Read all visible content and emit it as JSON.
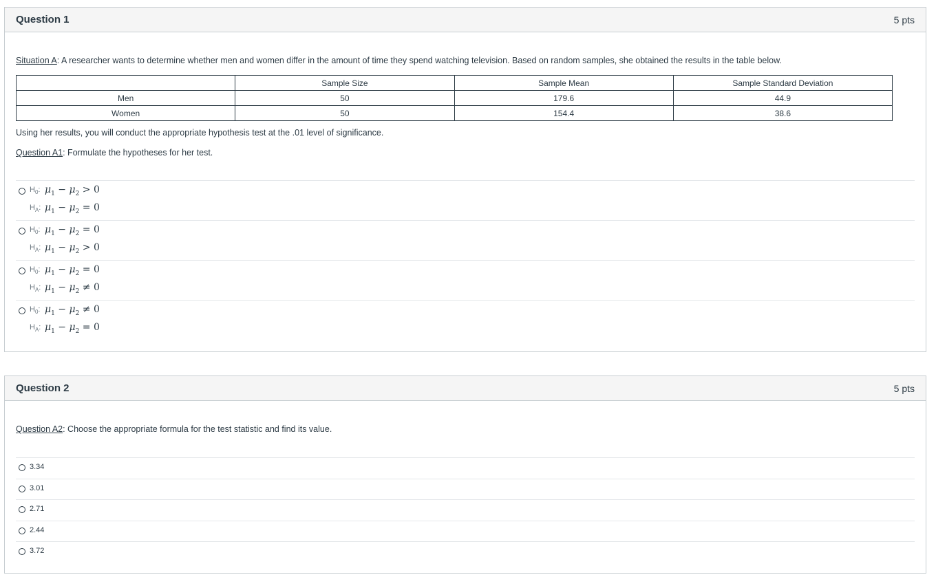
{
  "q1": {
    "title": "Question 1",
    "pts": "5 pts",
    "situation_link": "Situation A",
    "situation_text": ":  A researcher wants to determine whether men and women differ in the amount of time they spend watching television.  Based on random samples, she obtained the results in the table below.",
    "table": {
      "headers": [
        "",
        "Sample Size",
        "Sample Mean",
        "Sample Standard Deviation"
      ],
      "rows": [
        [
          "Men",
          "50",
          "179.6",
          "44.9"
        ],
        [
          "Women",
          "50",
          "154.4",
          "38.6"
        ]
      ]
    },
    "instructions": "Using her results, you will conduct the appropriate hypothesis test at the .01 level of significance.",
    "sub_link": "Question A1",
    "sub_text": ":  Formulate the hypotheses for her test.",
    "h0_label": "H",
    "h0_sub": "0",
    "ha_label": "H",
    "ha_sub": "A",
    "options": [
      {
        "h0_op": ">",
        "ha_op": "="
      },
      {
        "h0_op": "=",
        "ha_op": ">"
      },
      {
        "h0_op": "=",
        "ha_op": "≠"
      },
      {
        "h0_op": "≠",
        "ha_op": "="
      }
    ],
    "mu": "μ",
    "mu1_sub": "1",
    "mu2_sub": "2",
    "minus": "−",
    "zero": "0",
    "colon": ":"
  },
  "q2": {
    "title": "Question 2",
    "pts": "5 pts",
    "sub_link": "Question A2",
    "sub_text": ":  Choose the appropriate formula for the test statistic and find its value.",
    "options": [
      "3.34",
      "3.01",
      "2.71",
      "2.44",
      "3.72"
    ]
  }
}
